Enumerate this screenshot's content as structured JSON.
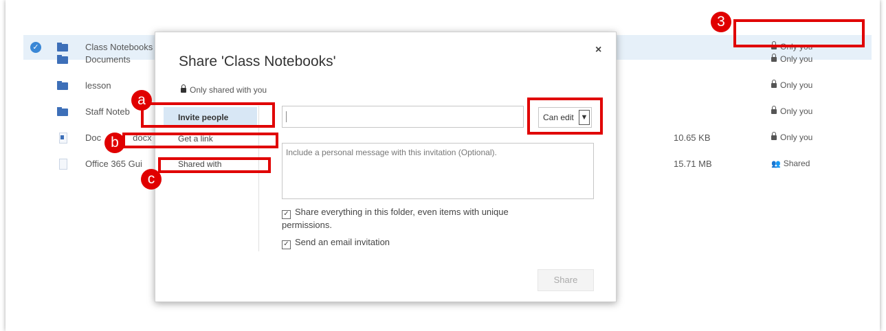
{
  "files": [
    {
      "name": "Class Notebooks",
      "size": "",
      "sharing": "Only you",
      "icon": "folder-icon",
      "selected": true
    },
    {
      "name": "Documents",
      "size": "",
      "sharing": "Only you",
      "icon": "folder-icon"
    },
    {
      "name": "lesson",
      "size": "",
      "sharing": "Only you",
      "icon": "folder-icon"
    },
    {
      "name": "Staff Noteb",
      "size": "",
      "sharing": "Only you",
      "icon": "folder-icon"
    },
    {
      "name": "Doc",
      "name_tail": "docx",
      "size": "10.65 KB",
      "sharing": "Only you",
      "icon": "word-doc-icon"
    },
    {
      "name": "Office 365 Gui",
      "size": "15.71 MB",
      "sharing": "Shared",
      "icon": "blank-doc-icon"
    }
  ],
  "dialog": {
    "title": "Share 'Class Notebooks'",
    "close_label": "×",
    "scope": "Only shared with you",
    "tabs": [
      "Invite people",
      "Get a link",
      "Shared with"
    ],
    "permission": "Can edit",
    "message_placeholder": "Include a personal message with this invitation (Optional).",
    "share_everything_label": "Share everything in this folder, even items with unique permissions.",
    "send_email_label": "Send an email invitation",
    "share_button": "Share"
  },
  "annotations": {
    "badge_3": "3",
    "badge_a": "a",
    "badge_b": "b",
    "badge_c": "c",
    "color": "#e00000"
  }
}
